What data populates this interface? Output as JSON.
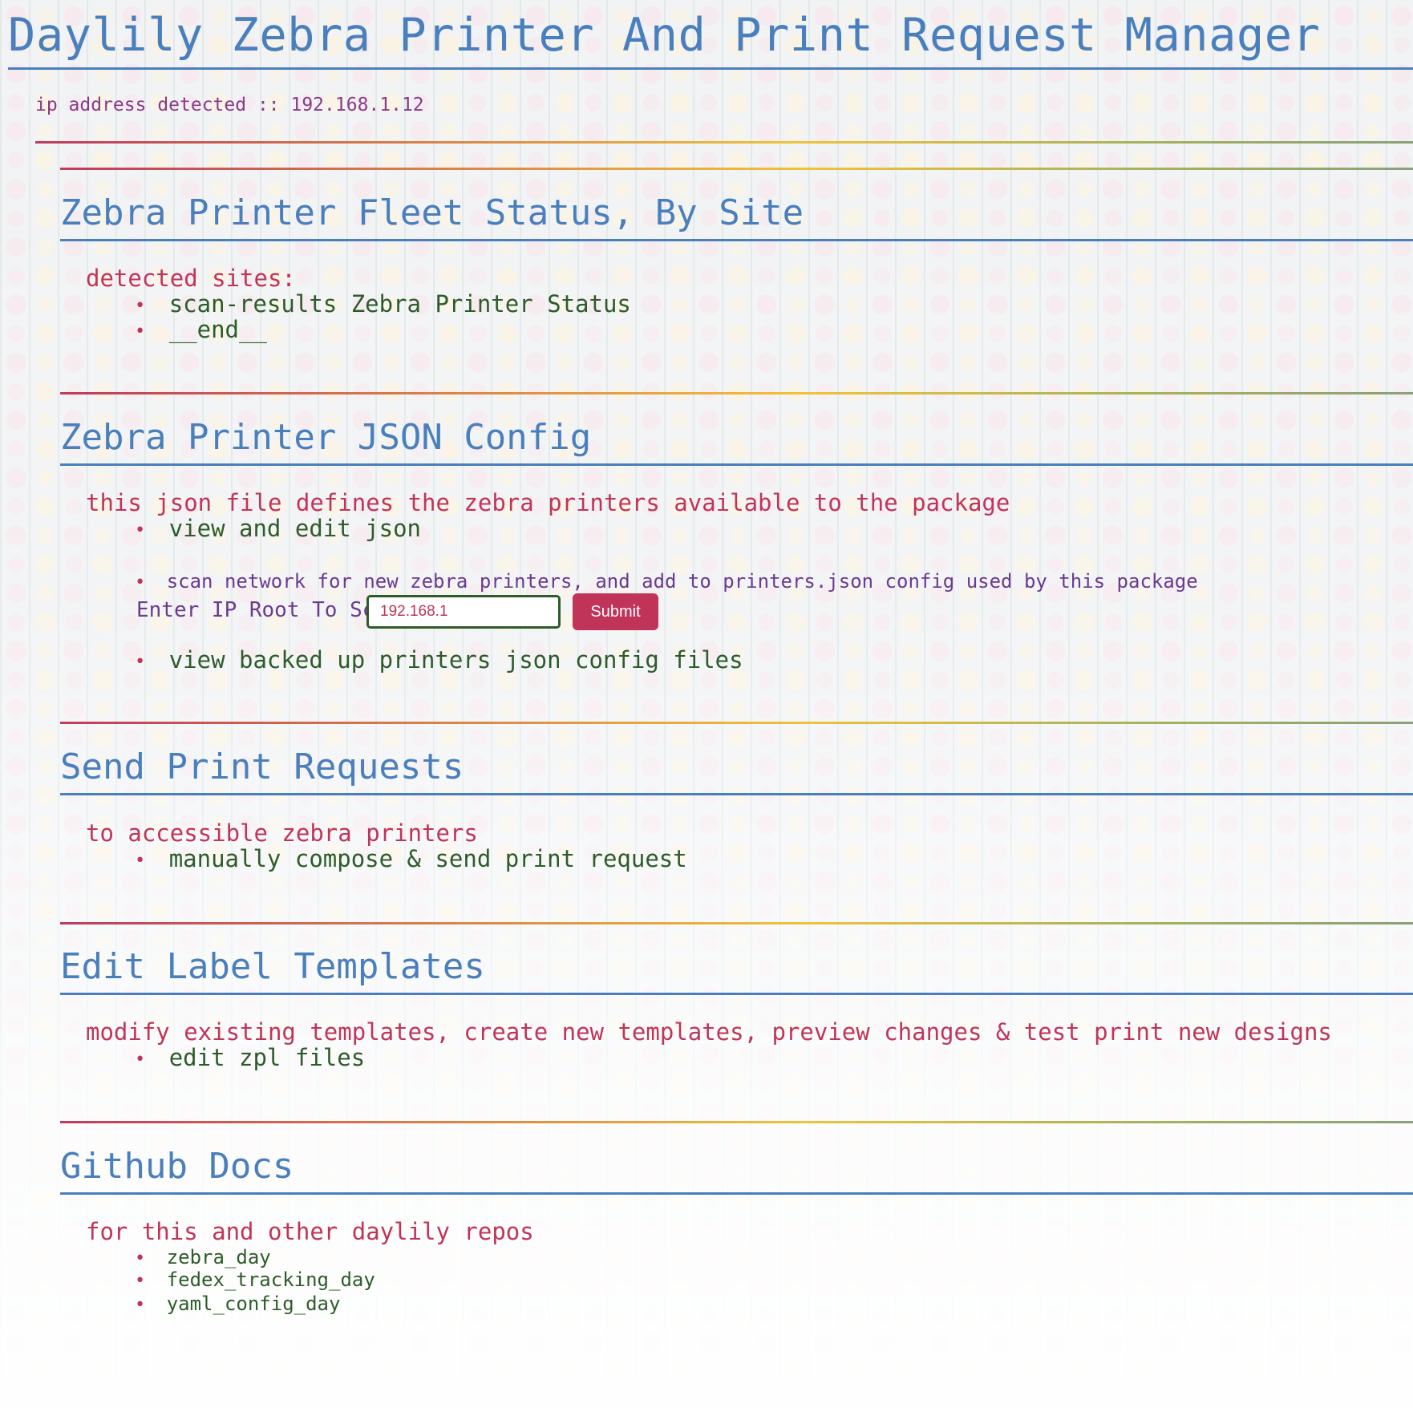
{
  "page": {
    "title": "Daylily Zebra Printer And Print Request Manager",
    "ip_text": "ip address detected :: 192.168.1.12"
  },
  "fleet": {
    "heading": "Zebra Printer Fleet Status, By Site",
    "intro": "detected sites:",
    "items": [
      "scan-results Zebra Printer Status",
      "__end__"
    ]
  },
  "config": {
    "heading": "Zebra Printer JSON Config",
    "intro": "this json file defines the zebra printers available to the package",
    "view_edit": "view and edit json",
    "scan_text": "scan network for new zebra printers, and add to printers.json config used by this package",
    "scan_label": "Enter IP Root To Scan:",
    "scan_value": "192.168.1",
    "submit_label": "Submit",
    "backups": "view backed up printers json config files"
  },
  "print": {
    "heading": "Send Print Requests",
    "intro": "to accessible zebra printers",
    "compose": "manually compose & send print request"
  },
  "templates": {
    "heading": "Edit Label Templates",
    "intro": "modify existing templates, create new templates, preview changes & test print new designs",
    "edit": "edit zpl files"
  },
  "docs": {
    "heading": "Github Docs",
    "intro": "for this and other daylily repos",
    "repos": [
      "zebra_day",
      "fedex_tracking_day",
      "yaml_config_day"
    ]
  },
  "colors": {
    "heading_blue": "#4a7fbd",
    "accent_red": "#c0345a",
    "link_green": "#2d5c2a",
    "purple_text": "#8a3a86"
  }
}
